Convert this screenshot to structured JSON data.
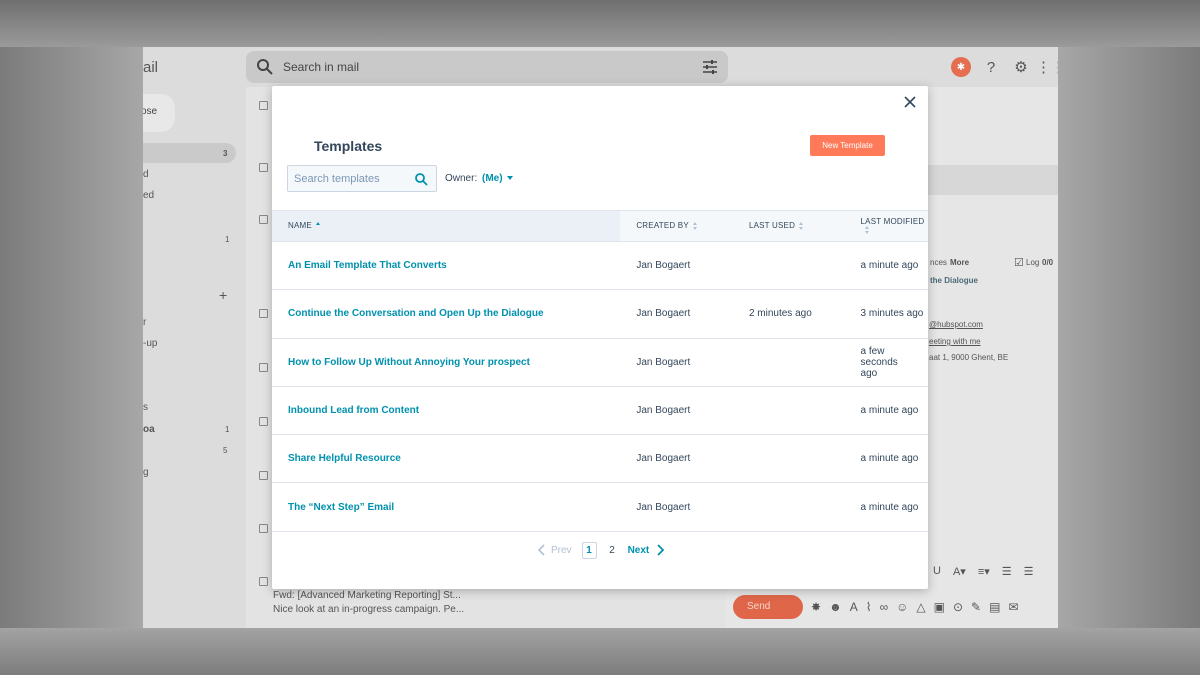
{
  "gmail": {
    "brand": "ail",
    "search_placeholder": "Search in mail",
    "compose_label": "ose",
    "sidebar": [
      {
        "label": "",
        "count": "3"
      },
      {
        "label": "d",
        "count": ""
      },
      {
        "label": "ed",
        "count": ""
      },
      {
        "label": "",
        "count": "1"
      },
      {
        "label": "r",
        "count": ""
      },
      {
        "label": "-up",
        "count": ""
      },
      {
        "label": "s",
        "count": ""
      },
      {
        "label": "oa",
        "count": "1"
      },
      {
        "label": "",
        "count": "5"
      },
      {
        "label": "g",
        "count": ""
      }
    ],
    "list_bottom_subject": "Fwd: [Advanced Marketing Reporting] St...",
    "list_bottom_snippet": "Nice look at an in-progress campaign. Pe...",
    "right_pane": {
      "more_label": "More",
      "log_label": "Log",
      "log_count": "0/0",
      "nces": "nces",
      "subject_frag": "the Dialogue",
      "email_frag": "@hubspot.com",
      "meeting_frag": "eeting with me",
      "address_frag": "aat 1, 9000 Ghent, BE"
    },
    "send_label": "Send"
  },
  "modal": {
    "title": "Templates",
    "new_template_label": "New Template",
    "search_placeholder": "Search templates",
    "owner_label": "Owner:",
    "owner_value": "(Me)",
    "columns": {
      "name": "NAME",
      "created_by": "CREATED BY",
      "last_used": "LAST USED",
      "last_modified": "LAST MODIFIED"
    },
    "rows": [
      {
        "name": "An Email Template That Converts",
        "created_by": "Jan Bogaert",
        "last_used": "",
        "last_modified": "a minute ago"
      },
      {
        "name": "Continue the Conversation and Open Up the Dialogue",
        "created_by": "Jan Bogaert",
        "last_used": "2 minutes ago",
        "last_modified": "3 minutes ago"
      },
      {
        "name": "How to Follow Up Without Annoying Your prospect",
        "created_by": "Jan Bogaert",
        "last_used": "",
        "last_modified": "a few seconds ago"
      },
      {
        "name": "Inbound Lead from Content",
        "created_by": "Jan Bogaert",
        "last_used": "",
        "last_modified": "a minute ago"
      },
      {
        "name": "Share Helpful Resource",
        "created_by": "Jan Bogaert",
        "last_used": "",
        "last_modified": "a minute ago"
      },
      {
        "name": "The “Next Step” Email",
        "created_by": "Jan Bogaert",
        "last_used": "",
        "last_modified": "a minute ago"
      }
    ],
    "pager": {
      "prev": "Prev",
      "page1": "1",
      "page2": "2",
      "next": "Next"
    }
  },
  "colors": {
    "accent": "#0091ae",
    "cta": "#ff7a59",
    "text": "#33475b"
  }
}
